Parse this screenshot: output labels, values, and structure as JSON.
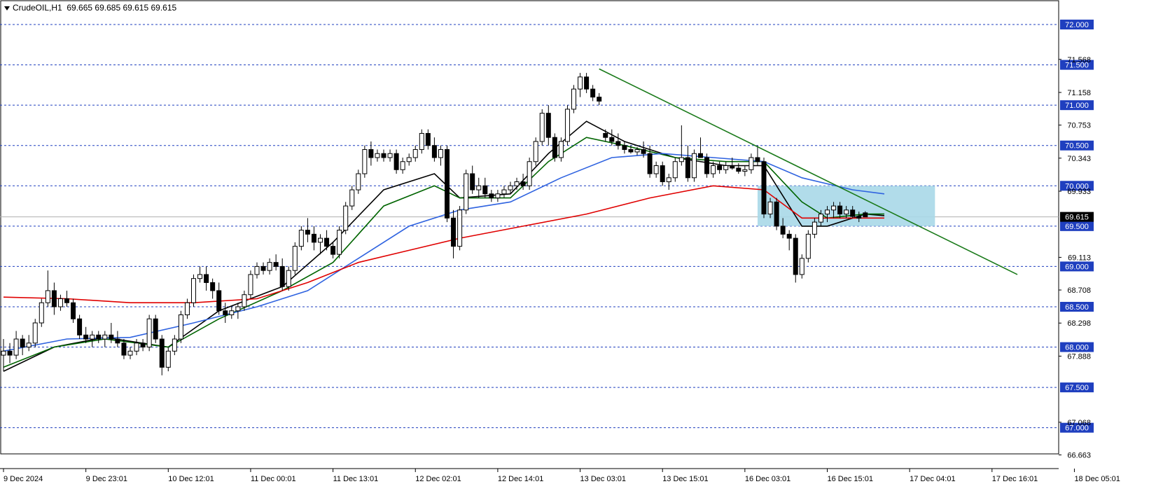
{
  "header": {
    "symbol": "CrudeOIL,H1",
    "ohlc": "69.665 69.685 69.615 69.615"
  },
  "colors": {
    "background": "#ffffff",
    "grid": "#1f3fbf",
    "bull": "#ffffff",
    "bear": "#000000",
    "ma_fast": "#000000",
    "ma_mid": "#006400",
    "ma_slow": "#2f63e0",
    "ma_long": "#e00000",
    "trendline": "#1a7a1a",
    "zone": "#a8d8e8",
    "label_bg": "#1f3fbf",
    "label_text": "#ffffff"
  },
  "chart_data": {
    "type": "candlestick",
    "title": "CrudeOIL,H1",
    "ylim": [
      66.45,
      72.2
    ],
    "y_ticks": [
      "71.568",
      "71.158",
      "70.753",
      "70.343",
      "69.933",
      "69.113",
      "68.708",
      "68.298",
      "67.888",
      "67.068",
      "66.663"
    ],
    "price_levels": [
      "72.000",
      "71.500",
      "71.000",
      "70.500",
      "70.000",
      "69.500",
      "69.000",
      "68.500",
      "68.000",
      "67.500",
      "67.000"
    ],
    "current_price": "69.615",
    "x_labels": [
      "9 Dec 2024",
      "9 Dec 23:01",
      "10 Dec 12:01",
      "11 Dec 00:01",
      "11 Dec 13:01",
      "12 Dec 02:01",
      "12 Dec 14:01",
      "13 Dec 03:01",
      "13 Dec 15:01",
      "16 Dec 03:01",
      "16 Dec 15:01",
      "17 Dec 04:01",
      "17 Dec 16:01",
      "18 Dec 05:01"
    ],
    "bars_per_label": 13,
    "candles": [
      [
        67.9,
        68.1,
        67.7,
        67.95
      ],
      [
        67.95,
        68.05,
        67.8,
        67.9
      ],
      [
        67.9,
        68.2,
        67.85,
        68.1
      ],
      [
        68.1,
        68.15,
        67.9,
        68.0
      ],
      [
        68.0,
        68.15,
        67.95,
        68.05
      ],
      [
        68.05,
        68.35,
        68.0,
        68.3
      ],
      [
        68.3,
        68.6,
        68.25,
        68.55
      ],
      [
        68.55,
        68.95,
        68.5,
        68.7
      ],
      [
        68.7,
        68.8,
        68.4,
        68.5
      ],
      [
        68.5,
        68.65,
        68.45,
        68.6
      ],
      [
        68.6,
        68.7,
        68.5,
        68.55
      ],
      [
        68.55,
        68.6,
        68.3,
        68.35
      ],
      [
        68.35,
        68.4,
        68.1,
        68.15
      ],
      [
        68.15,
        68.25,
        68.05,
        68.1
      ],
      [
        68.1,
        68.2,
        68.0,
        68.15
      ],
      [
        68.15,
        68.2,
        68.05,
        68.1
      ],
      [
        68.1,
        68.2,
        68.0,
        68.15
      ],
      [
        68.15,
        68.3,
        68.05,
        68.1
      ],
      [
        68.1,
        68.2,
        68.0,
        68.05
      ],
      [
        68.05,
        68.1,
        67.85,
        67.9
      ],
      [
        67.9,
        68.0,
        67.85,
        67.95
      ],
      [
        67.95,
        68.1,
        67.9,
        68.05
      ],
      [
        68.05,
        68.1,
        67.95,
        68.0
      ],
      [
        68.0,
        68.4,
        67.95,
        68.35
      ],
      [
        68.35,
        68.4,
        68.05,
        68.1
      ],
      [
        68.1,
        68.15,
        67.65,
        67.75
      ],
      [
        67.75,
        68.0,
        67.7,
        67.95
      ],
      [
        67.95,
        68.15,
        67.9,
        68.1
      ],
      [
        68.1,
        68.45,
        68.05,
        68.4
      ],
      [
        68.4,
        68.6,
        68.35,
        68.55
      ],
      [
        68.55,
        68.9,
        68.5,
        68.85
      ],
      [
        68.85,
        69.0,
        68.8,
        68.9
      ],
      [
        68.9,
        69.0,
        68.7,
        68.8
      ],
      [
        68.8,
        68.85,
        68.6,
        68.7
      ],
      [
        68.7,
        68.8,
        68.4,
        68.45
      ],
      [
        68.45,
        68.55,
        68.3,
        68.4
      ],
      [
        68.4,
        68.5,
        68.35,
        68.45
      ],
      [
        68.45,
        68.55,
        68.35,
        68.5
      ],
      [
        68.5,
        68.7,
        68.45,
        68.65
      ],
      [
        68.65,
        68.95,
        68.6,
        68.9
      ],
      [
        68.9,
        69.05,
        68.85,
        69.0
      ],
      [
        69.0,
        69.05,
        68.9,
        68.95
      ],
      [
        68.95,
        69.1,
        68.9,
        69.05
      ],
      [
        69.05,
        69.15,
        68.95,
        69.0
      ],
      [
        69.0,
        69.1,
        68.7,
        68.75
      ],
      [
        68.75,
        69.0,
        68.7,
        68.95
      ],
      [
        68.95,
        69.3,
        68.9,
        69.25
      ],
      [
        69.25,
        69.5,
        69.2,
        69.45
      ],
      [
        69.45,
        69.6,
        69.3,
        69.4
      ],
      [
        69.4,
        69.5,
        69.2,
        69.3
      ],
      [
        69.3,
        69.4,
        69.15,
        69.35
      ],
      [
        69.35,
        69.45,
        69.2,
        69.25
      ],
      [
        69.25,
        69.3,
        69.1,
        69.15
      ],
      [
        69.15,
        69.5,
        69.1,
        69.45
      ],
      [
        69.45,
        69.8,
        69.4,
        69.75
      ],
      [
        69.75,
        70.0,
        69.7,
        69.95
      ],
      [
        69.95,
        70.2,
        69.9,
        70.15
      ],
      [
        70.15,
        70.5,
        70.1,
        70.45
      ],
      [
        70.45,
        70.55,
        70.25,
        70.35
      ],
      [
        70.35,
        70.45,
        70.3,
        70.4
      ],
      [
        70.4,
        70.45,
        70.3,
        70.35
      ],
      [
        70.35,
        70.45,
        70.3,
        70.4
      ],
      [
        70.4,
        70.45,
        70.15,
        70.2
      ],
      [
        70.2,
        70.35,
        70.15,
        70.3
      ],
      [
        70.3,
        70.4,
        70.25,
        70.35
      ],
      [
        70.35,
        70.5,
        70.3,
        70.45
      ],
      [
        70.45,
        70.7,
        70.4,
        70.65
      ],
      [
        70.65,
        70.7,
        70.45,
        70.5
      ],
      [
        70.5,
        70.6,
        70.3,
        70.35
      ],
      [
        70.35,
        70.5,
        70.25,
        70.45
      ],
      [
        70.45,
        70.5,
        69.55,
        69.6
      ],
      [
        69.6,
        69.7,
        69.1,
        69.25
      ],
      [
        69.25,
        69.75,
        69.2,
        69.7
      ],
      [
        69.7,
        70.2,
        69.65,
        70.15
      ],
      [
        70.15,
        70.25,
        69.9,
        69.95
      ],
      [
        69.95,
        70.1,
        69.85,
        70.0
      ],
      [
        70.0,
        70.1,
        69.85,
        69.9
      ],
      [
        69.9,
        69.95,
        69.8,
        69.85
      ],
      [
        69.85,
        69.95,
        69.8,
        69.9
      ],
      [
        69.9,
        70.0,
        69.85,
        69.95
      ],
      [
        69.95,
        70.05,
        69.9,
        70.0
      ],
      [
        70.0,
        70.1,
        69.95,
        70.05
      ],
      [
        70.05,
        70.15,
        69.95,
        70.0
      ],
      [
        70.0,
        70.35,
        69.95,
        70.3
      ],
      [
        70.3,
        70.6,
        70.25,
        70.55
      ],
      [
        70.55,
        70.95,
        70.5,
        70.9
      ],
      [
        70.9,
        71.0,
        70.5,
        70.6
      ],
      [
        70.6,
        70.65,
        70.3,
        70.35
      ],
      [
        70.35,
        70.6,
        70.3,
        70.55
      ],
      [
        70.55,
        71.0,
        70.5,
        70.95
      ],
      [
        70.95,
        71.25,
        70.9,
        71.2
      ],
      [
        71.2,
        71.4,
        71.1,
        71.35
      ],
      [
        71.35,
        71.4,
        71.15,
        71.2
      ],
      [
        71.2,
        71.25,
        71.05,
        71.1
      ],
      [
        71.1,
        71.15,
        71.0,
        71.05
      ],
      [
        70.65,
        70.7,
        70.55,
        70.6
      ],
      [
        70.6,
        70.7,
        70.5,
        70.55
      ],
      [
        70.55,
        70.65,
        70.45,
        70.5
      ],
      [
        70.5,
        70.55,
        70.4,
        70.45
      ],
      [
        70.45,
        70.5,
        70.4,
        70.42
      ],
      [
        70.42,
        70.48,
        70.38,
        70.45
      ],
      [
        70.45,
        70.55,
        70.35,
        70.4
      ],
      [
        70.4,
        70.5,
        70.1,
        70.15
      ],
      [
        70.15,
        70.3,
        70.1,
        70.25
      ],
      [
        70.25,
        70.3,
        70.0,
        70.05
      ],
      [
        70.05,
        70.15,
        69.95,
        70.1
      ],
      [
        70.1,
        70.35,
        70.05,
        70.3
      ],
      [
        70.3,
        70.75,
        70.25,
        70.35
      ],
      [
        70.35,
        70.5,
        70.05,
        70.1
      ],
      [
        70.1,
        70.45,
        70.05,
        70.4
      ],
      [
        70.4,
        70.6,
        70.35,
        70.35
      ],
      [
        70.35,
        70.4,
        70.1,
        70.15
      ],
      [
        70.15,
        70.3,
        70.1,
        70.25
      ],
      [
        70.25,
        70.3,
        70.15,
        70.2
      ],
      [
        70.2,
        70.3,
        70.15,
        70.25
      ],
      [
        70.25,
        70.35,
        70.2,
        70.22
      ],
      [
        70.22,
        70.28,
        70.15,
        70.18
      ],
      [
        70.18,
        70.25,
        70.12,
        70.2
      ],
      [
        70.2,
        70.4,
        70.15,
        70.35
      ],
      [
        70.35,
        70.5,
        70.25,
        70.3
      ],
      [
        70.3,
        70.35,
        69.6,
        69.65
      ],
      [
        69.65,
        69.85,
        69.6,
        69.8
      ],
      [
        69.8,
        69.85,
        69.45,
        69.5
      ],
      [
        69.5,
        69.6,
        69.35,
        69.4
      ],
      [
        69.4,
        69.45,
        69.2,
        69.35
      ],
      [
        69.35,
        69.4,
        68.8,
        68.9
      ],
      [
        68.9,
        69.15,
        68.85,
        69.1
      ],
      [
        69.1,
        69.45,
        69.05,
        69.4
      ],
      [
        69.4,
        69.6,
        69.35,
        69.55
      ],
      [
        69.55,
        69.7,
        69.5,
        69.65
      ],
      [
        69.65,
        69.75,
        69.55,
        69.7
      ],
      [
        69.7,
        69.8,
        69.6,
        69.75
      ],
      [
        69.75,
        69.8,
        69.6,
        69.65
      ],
      [
        69.65,
        69.75,
        69.6,
        69.7
      ],
      [
        69.7,
        69.75,
        69.6,
        69.62
      ],
      [
        69.62,
        69.68,
        69.55,
        69.6
      ],
      [
        69.665,
        69.685,
        69.615,
        69.615
      ]
    ],
    "moving_averages": [
      {
        "color": "#000000",
        "points": [
          [
            0,
            67.7
          ],
          [
            8,
            68.0
          ],
          [
            16,
            68.12
          ],
          [
            26,
            68.0
          ],
          [
            34,
            68.45
          ],
          [
            44,
            68.75
          ],
          [
            52,
            69.3
          ],
          [
            60,
            69.95
          ],
          [
            68,
            70.15
          ],
          [
            72,
            69.85
          ],
          [
            80,
            69.9
          ],
          [
            86,
            70.4
          ],
          [
            92,
            70.8
          ],
          [
            98,
            70.55
          ],
          [
            106,
            70.35
          ],
          [
            114,
            70.25
          ],
          [
            120,
            70.25
          ],
          [
            126,
            69.5
          ],
          [
            130,
            69.5
          ],
          [
            136,
            69.65
          ],
          [
            139,
            69.63
          ]
        ]
      },
      {
        "color": "#006400",
        "points": [
          [
            0,
            67.75
          ],
          [
            8,
            68.0
          ],
          [
            16,
            68.1
          ],
          [
            26,
            68.0
          ],
          [
            34,
            68.35
          ],
          [
            44,
            68.7
          ],
          [
            52,
            69.05
          ],
          [
            60,
            69.75
          ],
          [
            68,
            70.0
          ],
          [
            72,
            69.85
          ],
          [
            80,
            69.85
          ],
          [
            86,
            70.3
          ],
          [
            92,
            70.6
          ],
          [
            98,
            70.5
          ],
          [
            106,
            70.35
          ],
          [
            114,
            70.3
          ],
          [
            120,
            70.3
          ],
          [
            126,
            69.8
          ],
          [
            130,
            69.6
          ],
          [
            136,
            69.65
          ],
          [
            139,
            69.65
          ]
        ]
      },
      {
        "color": "#2f63e0",
        "points": [
          [
            0,
            67.95
          ],
          [
            10,
            68.1
          ],
          [
            20,
            68.12
          ],
          [
            30,
            68.3
          ],
          [
            40,
            68.5
          ],
          [
            48,
            68.7
          ],
          [
            56,
            69.1
          ],
          [
            64,
            69.5
          ],
          [
            72,
            69.7
          ],
          [
            80,
            69.8
          ],
          [
            88,
            70.1
          ],
          [
            96,
            70.35
          ],
          [
            104,
            70.4
          ],
          [
            112,
            70.35
          ],
          [
            120,
            70.3
          ],
          [
            126,
            70.1
          ],
          [
            134,
            69.95
          ],
          [
            139,
            69.9
          ]
        ]
      },
      {
        "color": "#e00000",
        "points": [
          [
            0,
            68.62
          ],
          [
            10,
            68.6
          ],
          [
            20,
            68.55
          ],
          [
            30,
            68.55
          ],
          [
            40,
            68.6
          ],
          [
            48,
            68.8
          ],
          [
            56,
            69.05
          ],
          [
            64,
            69.2
          ],
          [
            72,
            69.35
          ],
          [
            82,
            69.5
          ],
          [
            92,
            69.65
          ],
          [
            102,
            69.85
          ],
          [
            112,
            70.0
          ],
          [
            120,
            69.95
          ],
          [
            126,
            69.6
          ],
          [
            130,
            69.6
          ],
          [
            139,
            69.6
          ]
        ]
      }
    ],
    "trendline": [
      [
        94,
        71.45
      ],
      [
        160,
        68.9
      ]
    ],
    "zone": {
      "x0": 119,
      "x1": 147,
      "y0": 69.5,
      "y1": 70.0
    },
    "grid": true
  }
}
